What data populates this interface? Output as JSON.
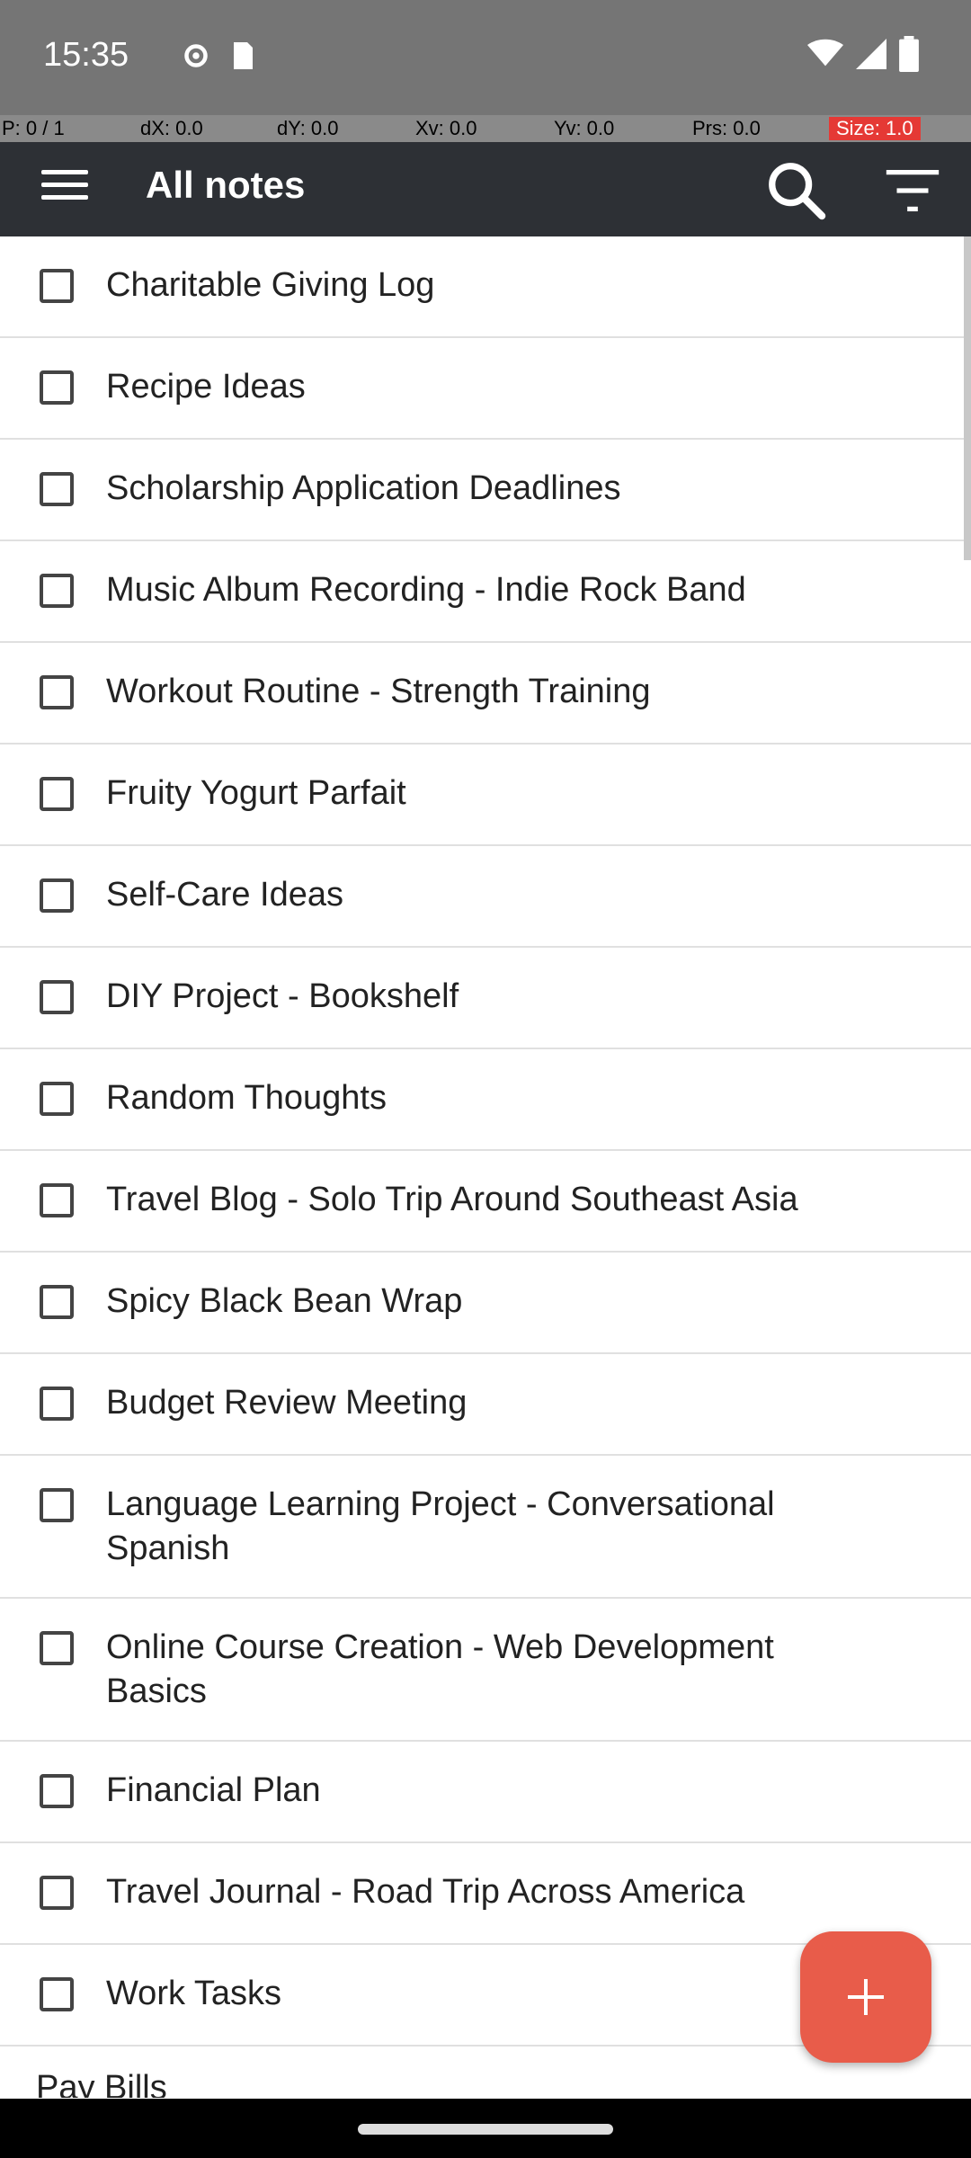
{
  "status": {
    "time": "15:35",
    "icons_left": [
      "settings-icon",
      "sd-card-icon"
    ],
    "icons_right": [
      "wifi-icon",
      "signal-icon",
      "battery-icon"
    ]
  },
  "pointer": {
    "p": "P: 0 / 1",
    "dx": "dX: 0.0",
    "dy": "dY: 0.0",
    "xv": "Xv: 0.0",
    "yv": "Yv: 0.0",
    "prs": "Prs: 0.0",
    "size": "Size: 1.0"
  },
  "app_bar": {
    "title": "All notes",
    "menu_icon": "menu-icon",
    "search_icon": "search-icon",
    "filter_icon": "filter-icon"
  },
  "notes": [
    "Charitable Giving Log",
    "Recipe Ideas",
    "Scholarship Application Deadlines",
    "Music Album Recording - Indie Rock Band",
    "Workout Routine - Strength Training",
    "Fruity Yogurt Parfait",
    "Self-Care Ideas",
    "DIY Project - Bookshelf",
    "Random Thoughts",
    "Travel Blog - Solo Trip Around Southeast Asia",
    "Spicy Black Bean Wrap",
    "Budget Review Meeting",
    "Language Learning Project - Conversational Spanish",
    "Online Course Creation - Web Development Basics",
    "Financial Plan",
    "Travel Journal - Road Trip Across America",
    "Work Tasks",
    "Pay Bills"
  ],
  "fab_icon": "plus-icon"
}
